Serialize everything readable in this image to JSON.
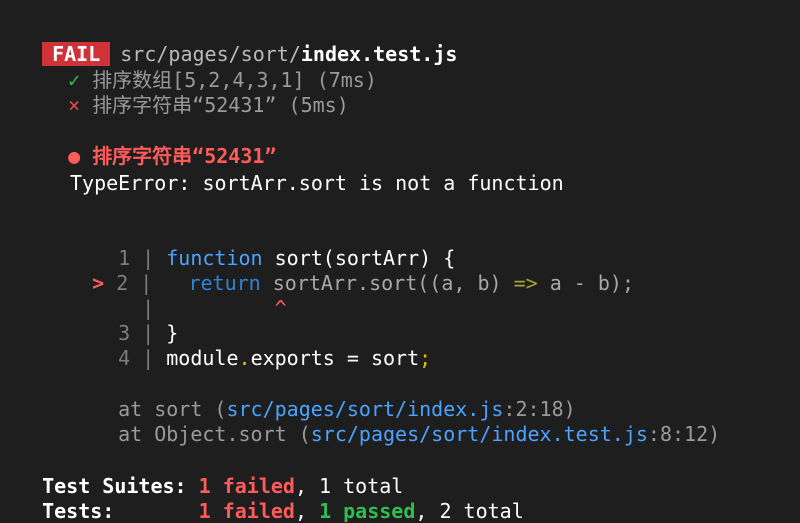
{
  "header": {
    "badge": "FAIL",
    "path_dim": "src/pages/sort/",
    "path_bold": "index.test.js"
  },
  "tests": [
    {
      "mark": "✓",
      "name": "排序数组[5,2,4,3,1]",
      "time": "(7ms)"
    },
    {
      "mark": "×",
      "name": "排序字符串“52431”",
      "time": "(5ms)"
    }
  ],
  "failure": {
    "bullet": "●",
    "title": "排序字符串“52431”",
    "error": "TypeError: sortArr.sort is not a function"
  },
  "code": {
    "line1_num": "1",
    "line1_kw": "function",
    "line1_rest": " sort(sortArr) {",
    "marker": ">",
    "line2_num": "2",
    "line2_kw": "return",
    "line2_a": " sortArr.",
    "line2_b": "sort",
    "line2_c": "((a, b) ",
    "line2_arrow": "=>",
    "line2_d": " a - b);",
    "caret": "^",
    "line3_num": "3",
    "line3_text": "}",
    "line4_num": "4",
    "line4_a": "module",
    "line4_dot": ".",
    "line4_b": "exports = sort",
    "line4_semi": ";"
  },
  "stack": [
    {
      "prefix": "at sort (",
      "link": "src/pages/sort/index.js",
      "pos": ":2:18)"
    },
    {
      "prefix": "at Object.sort (",
      "link": "src/pages/sort/index.test.js",
      "pos": ":8:12)"
    }
  ],
  "summary": {
    "suites_label": "Test Suites:",
    "suites_failed": "1 failed",
    "suites_total": ", 1 total",
    "tests_label": "Tests:",
    "tests_failed": "1 failed",
    "tests_sep": ", ",
    "tests_passed": "1 passed",
    "tests_total": ", 2 total"
  }
}
